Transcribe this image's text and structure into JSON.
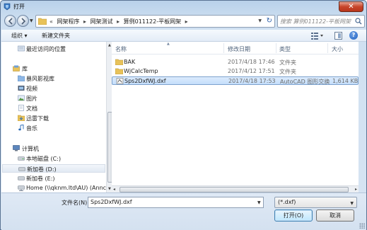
{
  "window": {
    "title": "打开",
    "close_label": "✕"
  },
  "address": {
    "crumbs": [
      "网架程序",
      "网架测试",
      "算例011122-平板网架"
    ],
    "lead": "«"
  },
  "search": {
    "placeholder": "搜索 算例011122-平板网架"
  },
  "toolbar": {
    "organize": "组织 ▾",
    "new_folder": "新建文件夹",
    "help": "?"
  },
  "nav": {
    "items": [
      {
        "label": "最近访问的位置",
        "icon": "recent-places-icon"
      },
      {
        "label": "库",
        "icon": "library-icon"
      },
      {
        "label": "暴风影视库",
        "icon": "library-folder-icon"
      },
      {
        "label": "视频",
        "icon": "video-icon"
      },
      {
        "label": "图片",
        "icon": "picture-icon"
      },
      {
        "label": "文档",
        "icon": "document-icon"
      },
      {
        "label": "迅雷下载",
        "icon": "download-icon"
      },
      {
        "label": "音乐",
        "icon": "music-icon"
      },
      {
        "label": "计算机",
        "icon": "computer-icon"
      },
      {
        "label": "本地磁盘 (C:)",
        "icon": "drive-icon"
      },
      {
        "label": "新加卷 (D:)",
        "icon": "drive-icon"
      },
      {
        "label": "新加卷 (E:)",
        "icon": "drive-icon"
      },
      {
        "label": "Home (\\\\qknm.ltd\\AU) (Annc",
        "icon": "network-drive-icon"
      }
    ]
  },
  "columns": {
    "name": "名称",
    "date": "修改日期",
    "type": "类型",
    "size": "大小"
  },
  "files": [
    {
      "name": "BAK",
      "date": "2017/4/18 17:46",
      "type": "文件夹",
      "size": "",
      "icon": "folder-icon"
    },
    {
      "name": "WjCalcTemp",
      "date": "2017/4/12 17:51",
      "type": "文件夹",
      "size": "",
      "icon": "folder-icon"
    },
    {
      "name": "Sps2DxfWJ.dxf",
      "date": "2017/4/18 17:53",
      "type": "AutoCAD 图形交换",
      "size": "1,614 KB",
      "icon": "dxf-file-icon"
    }
  ],
  "bottom": {
    "filename_label": "文件名(N):",
    "filename_value": "Sps2DxfWJ.dxf",
    "filetype": "(*.dxf)",
    "open_label": "打开(O)",
    "cancel_label": "取消"
  },
  "colors": {
    "accent": "#3c7fb1",
    "selection": "#c4defb",
    "close": "#c7452a",
    "folder": "#e8c25a"
  }
}
